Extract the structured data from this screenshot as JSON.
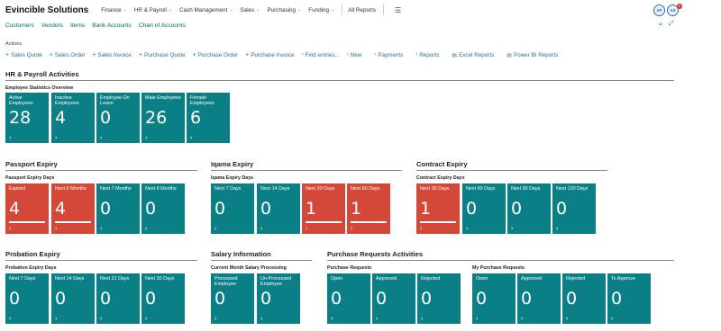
{
  "app": {
    "company": "Evincible Solutions"
  },
  "nav": {
    "menu": [
      {
        "label": "Finance",
        "chevron": true
      },
      {
        "label": "HR & Payroll",
        "chevron": true
      },
      {
        "label": "Cash Management",
        "chevron": true
      },
      {
        "label": "Sales",
        "chevron": true
      },
      {
        "label": "Purchasing",
        "chevron": true
      },
      {
        "label": "Funding",
        "chevron": true
      }
    ],
    "all_reports": "All Reports",
    "links": [
      "Customers",
      "Vendors",
      "Items",
      "Bank Accounts",
      "Chart of Accounts"
    ]
  },
  "user": {
    "avatar1": "SP",
    "avatar2": "AS",
    "notif_count": "5"
  },
  "actions": {
    "label": "Actions",
    "items": [
      {
        "label": "Sales Quote",
        "icon": "plus-icon"
      },
      {
        "label": "Sales Order",
        "icon": "plus-icon"
      },
      {
        "label": "Sales Invoice",
        "icon": "plus-icon"
      },
      {
        "label": "Purchase Quote",
        "icon": "plus-icon"
      },
      {
        "label": "Purchase Order",
        "icon": "plus-icon"
      },
      {
        "label": "Purchase Invoice",
        "icon": "plus-icon"
      },
      {
        "label": "Find entries...",
        "icon": "chevron-right-icon"
      },
      {
        "label": "New",
        "icon": "chevron-right-icon"
      },
      {
        "label": "Payments",
        "icon": "chevron-right-icon"
      },
      {
        "label": "Reports",
        "icon": "chevron-right-icon"
      },
      {
        "label": "Excel Reports",
        "icon": "report-icon"
      },
      {
        "label": "Power BI Reports",
        "icon": "report-icon"
      }
    ]
  },
  "hr": {
    "title": "HR & Payroll Activities",
    "group": "Employee Statistics Overview",
    "tiles": [
      {
        "label": "Active Employees",
        "value": "28",
        "color": "teal"
      },
      {
        "label": "Inactive Employees",
        "value": "4",
        "color": "teal"
      },
      {
        "label": "Employee On Leave",
        "value": "0",
        "color": "teal"
      },
      {
        "label": "Male Employees",
        "value": "26",
        "color": "teal"
      },
      {
        "label": "Female Employees",
        "value": "6",
        "color": "teal"
      }
    ]
  },
  "passport": {
    "title": "Passport Expiry",
    "group": "Passport Expiry Days",
    "tiles": [
      {
        "label": "Expired",
        "value": "4",
        "color": "red"
      },
      {
        "label": "Next 6 Months",
        "value": "4",
        "color": "red"
      },
      {
        "label": "Next 7 Months",
        "value": "0",
        "color": "teal"
      },
      {
        "label": "Next 9 Months",
        "value": "0",
        "color": "teal"
      }
    ]
  },
  "iqama": {
    "title": "Iqama Expiry",
    "group": "Iqama Expiry Days",
    "tiles": [
      {
        "label": "Next 7 Days",
        "value": "0",
        "color": "teal"
      },
      {
        "label": "Next 14 Days",
        "value": "0",
        "color": "teal"
      },
      {
        "label": "Next 30 Days",
        "value": "1",
        "color": "red"
      },
      {
        "label": "Next 60 Days",
        "value": "1",
        "color": "red"
      }
    ]
  },
  "contract": {
    "title": "Contract Expiry",
    "group": "Contract Expiry Days",
    "tiles": [
      {
        "label": "Next 30 Days",
        "value": "1",
        "color": "red"
      },
      {
        "label": "Next 60 Days",
        "value": "0",
        "color": "teal"
      },
      {
        "label": "Next 90 Days",
        "value": "0",
        "color": "teal"
      },
      {
        "label": "Next 120 Days",
        "value": "0",
        "color": "teal"
      }
    ]
  },
  "probation": {
    "title": "Probation Expiry",
    "group": "Probation Expiry Days",
    "tiles": [
      {
        "label": "Next 7 Days",
        "value": "0",
        "color": "teal"
      },
      {
        "label": "Next 14 Days",
        "value": "0",
        "color": "teal"
      },
      {
        "label": "Next 21 Days",
        "value": "0",
        "color": "teal"
      },
      {
        "label": "Next 30 Days",
        "value": "0",
        "color": "teal"
      }
    ]
  },
  "salary": {
    "title": "Salary Information",
    "group": "Current Month Salary Processing",
    "tiles": [
      {
        "label": "Processed Employee",
        "value": "0",
        "color": "teal"
      },
      {
        "label": "Un-Processed Employee",
        "value": "0",
        "color": "teal"
      }
    ]
  },
  "purchase": {
    "title": "Purchase Requests Activities",
    "group1": "Purchase Requests",
    "group2": "My Purchase Requests",
    "tiles1": [
      {
        "label": "Open",
        "value": "0",
        "color": "teal"
      },
      {
        "label": "Approved",
        "value": "0",
        "color": "teal"
      },
      {
        "label": "Rejected",
        "value": "0",
        "color": "teal"
      }
    ],
    "tiles2": [
      {
        "label": "Open",
        "value": "0",
        "color": "teal"
      },
      {
        "label": "Approved",
        "value": "0",
        "color": "teal"
      },
      {
        "label": "Rejected",
        "value": "0",
        "color": "teal"
      },
      {
        "label": "To Approve",
        "value": "0",
        "color": "teal"
      }
    ]
  },
  "colors": {
    "teal": "#0b7f86",
    "red": "#d4483a",
    "link": "#006a70",
    "action": "#2b6f95"
  }
}
